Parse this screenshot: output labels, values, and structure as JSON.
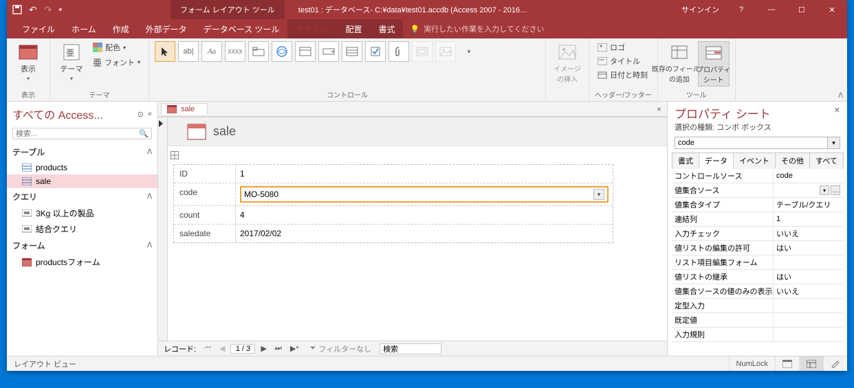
{
  "titlebar": {
    "tool_tab": "フォーム レイアウト ツール",
    "doc_title": "test01 : データベース- C:¥data¥test01.accdb (Access 2007 - 2016…",
    "signin": "サインイン"
  },
  "ribbon_tabs": [
    "ファイル",
    "ホーム",
    "作成",
    "外部データ",
    "データベース ツール",
    "デザイン",
    "配置",
    "書式"
  ],
  "ribbon_active": 5,
  "tell_me": "実行したい作業を入力してください",
  "ribbon_groups": {
    "view": {
      "btn": "表示",
      "label": "表示"
    },
    "themes": {
      "btn": "テーマ",
      "colors": "配色",
      "fonts": "フォント",
      "label": "テーマ"
    },
    "controls": {
      "label": "コントロール"
    },
    "image_insert": {
      "btn": "イメージ\nの挿入"
    },
    "headerfooter": {
      "logo": "ロゴ",
      "title": "タイトル",
      "date": "日付と時刻",
      "label": "ヘッダー/フッター"
    },
    "tools": {
      "fields": "既存のフィールド\nの追加",
      "props": "プロパティ\nシート",
      "label": "ツール"
    }
  },
  "nav": {
    "header": "すべての Access...",
    "search_ph": "検索...",
    "cats": [
      {
        "name": "テーブル",
        "items": [
          "products",
          "sale"
        ],
        "sel": 1
      },
      {
        "name": "クエリ",
        "items": [
          "3Kg 以上の製品",
          "結合クエリ"
        ]
      },
      {
        "name": "フォーム",
        "items": [
          "productsフォーム"
        ]
      }
    ]
  },
  "doc_tab": "sale",
  "form": {
    "title": "sale",
    "rows": [
      {
        "label": "ID",
        "value": "1"
      },
      {
        "label": "code",
        "value": "MO-5080",
        "combo": true
      },
      {
        "label": "count",
        "value": "4"
      },
      {
        "label": "saledate",
        "value": "2017/02/02"
      }
    ]
  },
  "recnav": {
    "label": "レコード:",
    "pos": "1 / 3",
    "filter": "フィルターなし",
    "search": "検索"
  },
  "prop": {
    "title": "プロパティ シート",
    "subtitle": "選択の種類: コンボ ボックス",
    "selected": "code",
    "tabs": [
      "書式",
      "データ",
      "イベント",
      "その他",
      "すべて"
    ],
    "active_tab": 1,
    "rows": [
      {
        "n": "コントロールソース",
        "v": "code"
      },
      {
        "n": "値集合ソース",
        "v": "",
        "dd": true,
        "dots": true
      },
      {
        "n": "値集合タイプ",
        "v": "テーブル/クエリ"
      },
      {
        "n": "連結列",
        "v": "1"
      },
      {
        "n": "入力チェック",
        "v": "いいえ"
      },
      {
        "n": "値リストの編集の許可",
        "v": "はい"
      },
      {
        "n": "リスト項目編集フォーム",
        "v": ""
      },
      {
        "n": "値リストの継承",
        "v": "はい"
      },
      {
        "n": "値集合ソースの値のみの表示",
        "v": "いいえ"
      },
      {
        "n": "定型入力",
        "v": ""
      },
      {
        "n": "既定値",
        "v": ""
      },
      {
        "n": "入力規則",
        "v": ""
      }
    ]
  },
  "status": {
    "view": "レイアウト ビュー",
    "numlock": "NumLock"
  }
}
